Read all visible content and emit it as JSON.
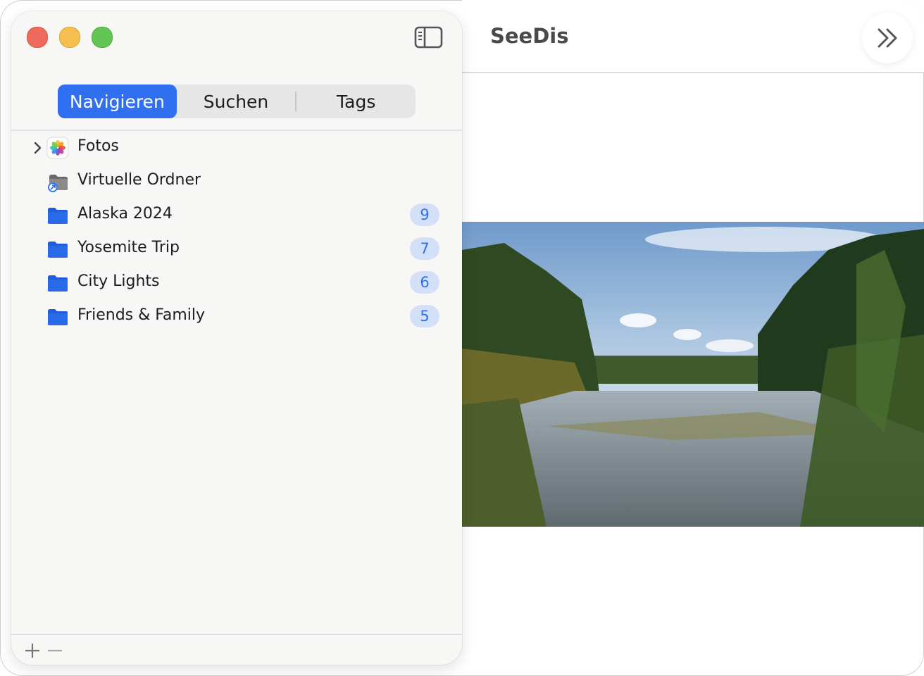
{
  "app": {
    "title": "SeeDis"
  },
  "sidebar": {
    "tabs": [
      {
        "label": "Navigieren",
        "active": true
      },
      {
        "label": "Suchen",
        "active": false
      },
      {
        "label": "Tags",
        "active": false
      }
    ],
    "items": [
      {
        "label": "Fotos",
        "icon": "photos-app-icon",
        "expandable": true,
        "count": null
      },
      {
        "label": "Virtuelle Ordner",
        "icon": "virtual-folder-icon",
        "expandable": false,
        "count": null
      },
      {
        "label": "Alaska 2024",
        "icon": "folder-icon",
        "expandable": false,
        "count": "9"
      },
      {
        "label": "Yosemite Trip",
        "icon": "folder-icon",
        "expandable": false,
        "count": "7"
      },
      {
        "label": "City Lights",
        "icon": "folder-icon",
        "expandable": false,
        "count": "6"
      },
      {
        "label": "Friends & Family",
        "icon": "folder-icon",
        "expandable": false,
        "count": "5"
      }
    ],
    "footer": {
      "add_label": "+",
      "remove_label": "−"
    }
  },
  "colors": {
    "accent": "#2f6ff0",
    "badge_bg": "#d3e0f8",
    "folder": "#2a6ae8"
  }
}
